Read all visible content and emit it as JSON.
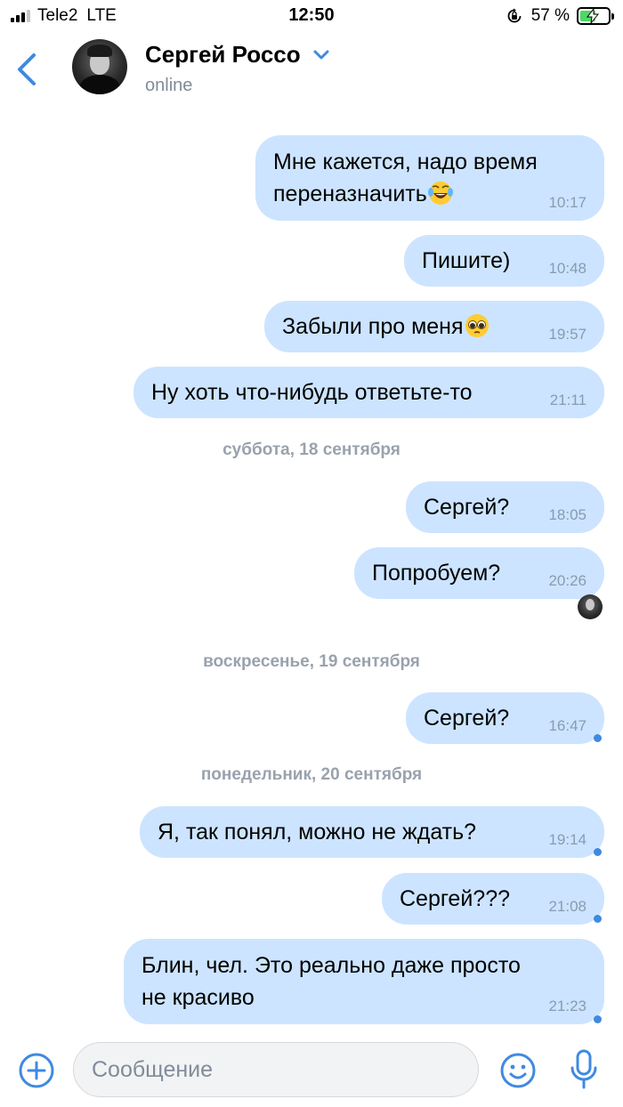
{
  "status_bar": {
    "carrier": "Tele2",
    "network": "LTE",
    "time": "12:50",
    "battery_percent": "57 %",
    "battery_level": 0.57
  },
  "header": {
    "contact_name": "Сергей Россо",
    "contact_status": "online"
  },
  "messages": [
    {
      "lines": [
        "Мне кажется, надо время",
        "переназначить"
      ],
      "emoji": "joy-emoji",
      "time": "10:17"
    },
    {
      "text": "Пишите)",
      "time": "10:48"
    },
    {
      "text": "Забыли про меня",
      "emoji": "pleading-face-emoji",
      "time": "19:57"
    },
    {
      "text": "Ну хоть что-нибудь ответьте-то",
      "time": "21:11"
    },
    {
      "text": "Сергей?",
      "time": "18:05"
    },
    {
      "text": "Попробуем?",
      "time": "20:26"
    },
    {
      "text": "Сергей?",
      "time": "16:47"
    },
    {
      "text": "Я, так понял, можно не ждать?",
      "time": "19:14"
    },
    {
      "text": "Сергей???",
      "time": "21:08"
    },
    {
      "lines": [
        "Блин, чел. Это реально даже просто",
        "не красиво"
      ],
      "time": "21:23"
    }
  ],
  "date_separators": [
    "суббота, 18 сентября",
    "воскресенье, 19 сентября",
    "понедельник, 20 сентября"
  ],
  "composer": {
    "placeholder": "Сообщение"
  },
  "colors": {
    "accent": "#3f8ae0",
    "bubble": "#cce4ff",
    "time_text": "#8a9bb0",
    "separator_text": "#99a2ad",
    "secondary_text": "#818c99"
  }
}
